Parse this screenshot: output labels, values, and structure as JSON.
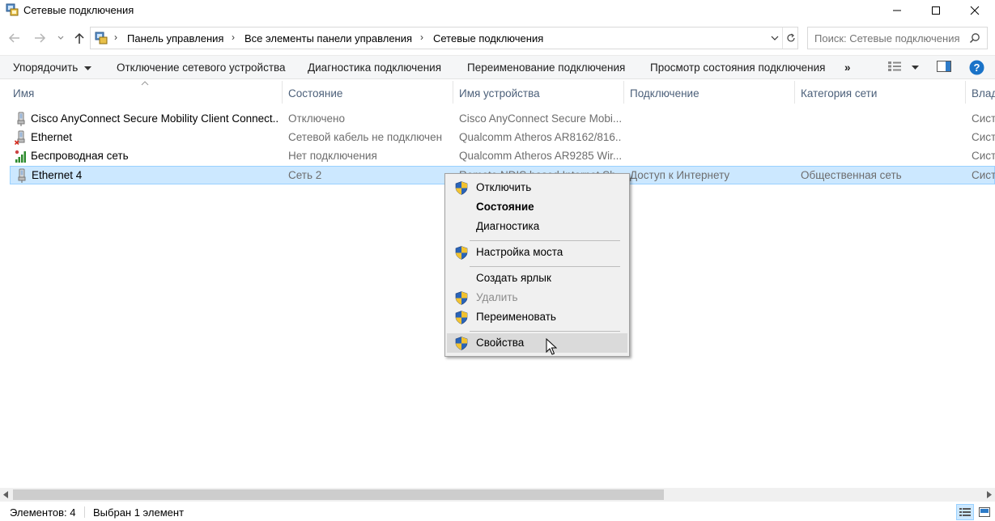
{
  "window": {
    "title": "Сетевые подключения",
    "minimize_icon": "minimize-icon",
    "maximize_icon": "maximize-icon",
    "close_icon": "close-icon"
  },
  "address": {
    "breadcrumbs": [
      "Панель управления",
      "Все элементы панели управления",
      "Сетевые подключения"
    ],
    "search_placeholder": "Поиск: Сетевые подключения"
  },
  "toolbar": {
    "organize": "Упорядочить",
    "disable_device": "Отключение сетевого устройства",
    "diagnose": "Диагностика подключения",
    "rename": "Переименование подключения",
    "view_status": "Просмотр состояния подключения",
    "more": "»"
  },
  "columns": {
    "name": "Имя",
    "status": "Состояние",
    "device": "Имя устройства",
    "connectivity": "Подключение",
    "network_category": "Категория сети",
    "owner": "Влад"
  },
  "rows": [
    {
      "name": "Cisco AnyConnect Secure Mobility Client Connect...",
      "status": "Отключено",
      "device": "Cisco AnyConnect Secure Mobi...",
      "connectivity": "",
      "category": "",
      "owner": "Сист",
      "icon": "network-adapter-icon"
    },
    {
      "name": "Ethernet",
      "status": "Сетевой кабель не подключен",
      "device": "Qualcomm Atheros AR8162/816...",
      "connectivity": "",
      "category": "",
      "owner": "Сист",
      "icon": "network-adapter-disconnected-icon"
    },
    {
      "name": "Беспроводная сеть",
      "status": "Нет подключения",
      "device": "Qualcomm Atheros AR9285 Wir...",
      "connectivity": "",
      "category": "",
      "owner": "Сист",
      "icon": "wireless-adapter-icon"
    },
    {
      "name": "Ethernet 4",
      "status": "Сеть 2",
      "device": "Remote NDIS based Internet Sh...",
      "connectivity": "Доступ к Интернету",
      "category": "Общественная сеть",
      "owner": "Сист",
      "icon": "network-adapter-icon"
    }
  ],
  "context_menu": {
    "items": [
      {
        "label": "Отключить",
        "shield": true
      },
      {
        "label": "Состояние",
        "shield": false
      },
      {
        "label": "Диагностика",
        "shield": false
      },
      {
        "label": "Настройка моста",
        "shield": true
      },
      {
        "label": "Создать ярлык",
        "shield": false
      },
      {
        "label": "Удалить",
        "shield": true
      },
      {
        "label": "Переименовать",
        "shield": true
      },
      {
        "label": "Свойства",
        "shield": true
      }
    ]
  },
  "status": {
    "items_count": "Элементов: 4",
    "selected": "Выбран 1 элемент"
  },
  "colors": {
    "selection_bg": "#cce8ff",
    "selection_border": "#99d1ff",
    "header_text": "#4c607a",
    "menu_bg": "#f0f0f0",
    "help_blue": "#1a73c8"
  }
}
